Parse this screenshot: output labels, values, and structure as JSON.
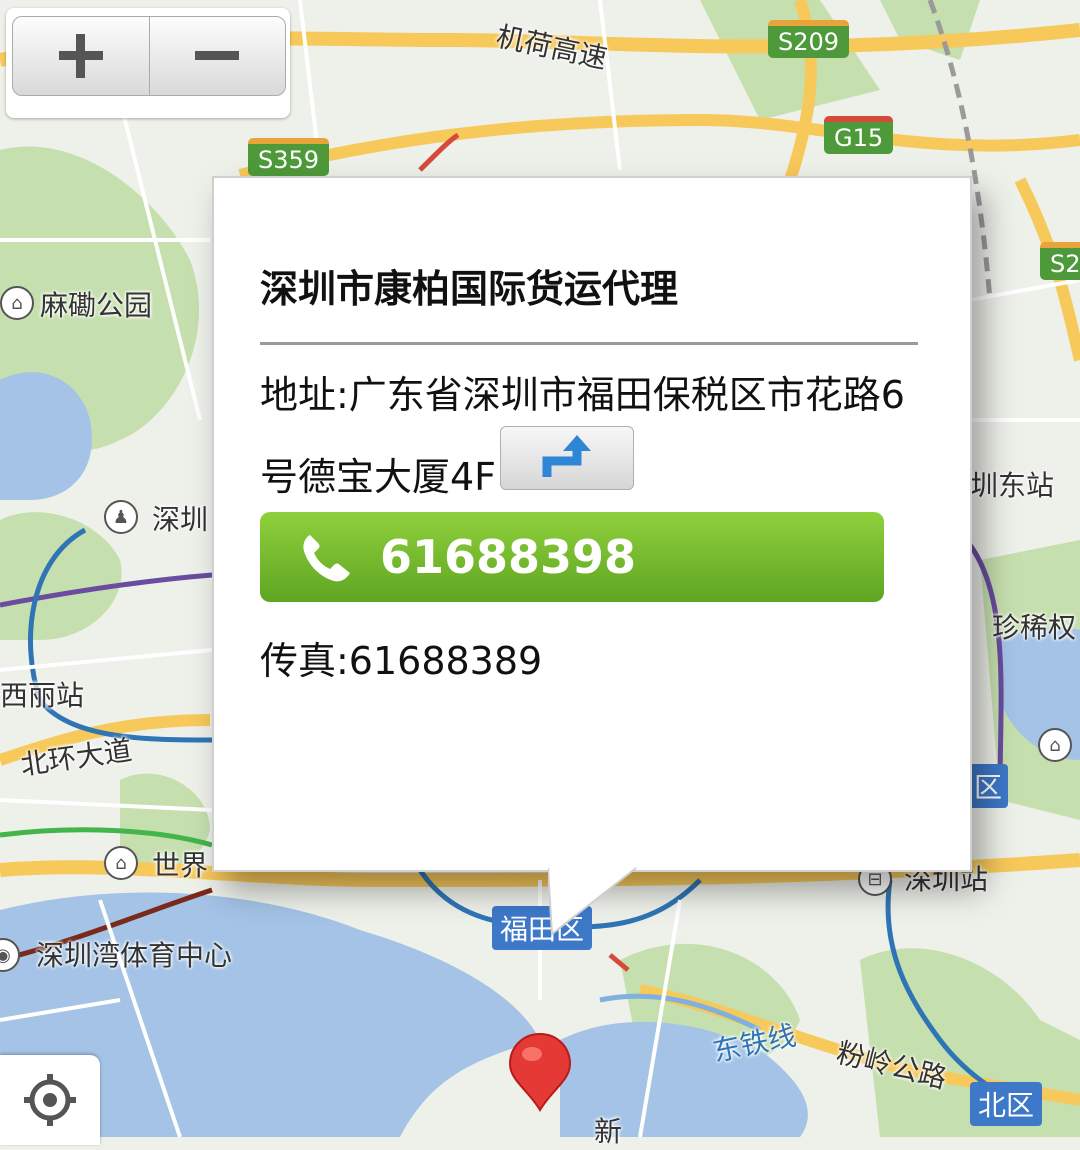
{
  "map": {
    "highways": [
      "S209",
      "G15",
      "S359",
      "S2"
    ],
    "road_labels": [
      "机荷高速",
      "北环大道",
      "东铁线",
      "粉岭公路",
      "新"
    ],
    "place_labels": [
      "麻磡公园",
      "深圳",
      "西丽站",
      "世界",
      "深圳湾体育中心",
      "圳东站",
      "珍稀权",
      "深圳站"
    ],
    "districts": [
      "福田区",
      "北区",
      "区"
    ],
    "colors": {
      "water": "#a4c3e6",
      "park": "#c6dfae",
      "highway": "#f7c95a",
      "metro_blue": "#2f75b5",
      "metro_purple": "#6a4ca0",
      "metro_green": "#43b54b",
      "metro_red": "#b23a3a"
    }
  },
  "controls": {
    "zoom_in": "+",
    "zoom_out": "−",
    "zoom_in_icon": "plus-icon",
    "zoom_out_icon": "minus-icon",
    "locate_icon": "locate-icon"
  },
  "popup": {
    "title": "深圳市康柏国际货运代理",
    "address": "地址:广东省深圳市福田保税区市花路6号德宝大厦4F",
    "route_icon": "route-turn-icon",
    "phone": "61688398",
    "phone_icon": "phone-icon",
    "fax": "传真:61688389",
    "colors": {
      "phone_bg": "#6fb82c"
    }
  },
  "marker": {
    "icon": "map-pin-icon",
    "color": "#e53935"
  }
}
